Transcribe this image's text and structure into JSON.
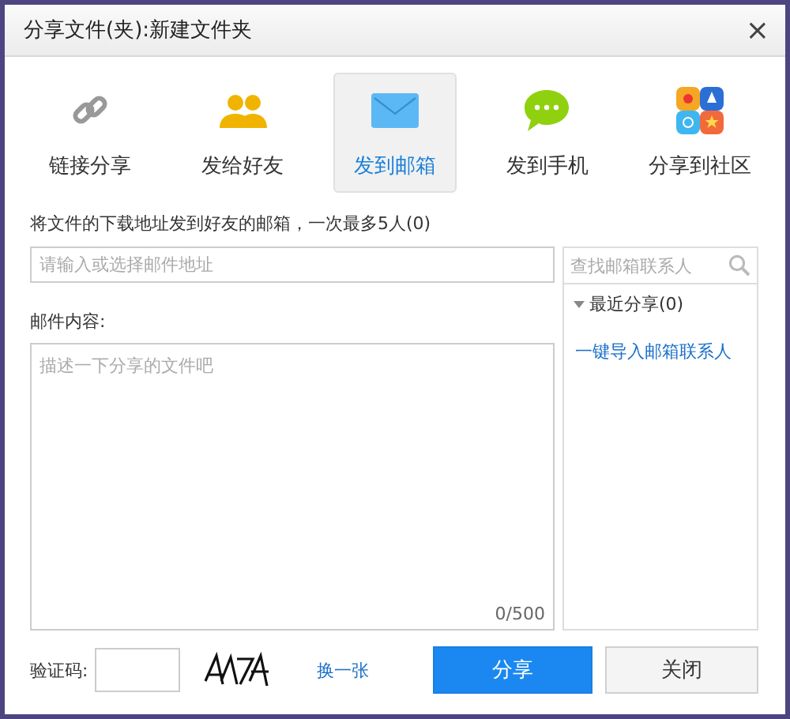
{
  "window": {
    "title": "分享文件(夹):新建文件夹",
    "close": "×"
  },
  "tabs": [
    {
      "label": "链接分享",
      "kind": "link",
      "selected": false
    },
    {
      "label": "发给好友",
      "kind": "friends",
      "selected": false
    },
    {
      "label": "发到邮箱",
      "kind": "mail",
      "selected": true
    },
    {
      "label": "发到手机",
      "kind": "chat",
      "selected": false
    },
    {
      "label": "分享到社区",
      "kind": "community",
      "selected": false
    }
  ],
  "hint": "将文件的下载地址发到好友的邮箱，一次最多5人(0)",
  "email_field": {
    "placeholder": "请输入或选择邮件地址"
  },
  "content_label": "邮件内容:",
  "content_field": {
    "placeholder": "描述一下分享的文件吧",
    "counter": "0/500"
  },
  "contacts": {
    "search": {
      "placeholder": "查找邮箱联系人"
    },
    "groups": [
      {
        "label": "最近分享(0)",
        "expanded": true
      }
    ],
    "import_link": "一键导入邮箱联系人"
  },
  "captcha": {
    "label": "验证码:",
    "refresh_link": "换一张"
  },
  "buttons": [
    {
      "label": "分享",
      "kind": "primary"
    },
    {
      "label": "关闭",
      "kind": "secondary"
    }
  ]
}
